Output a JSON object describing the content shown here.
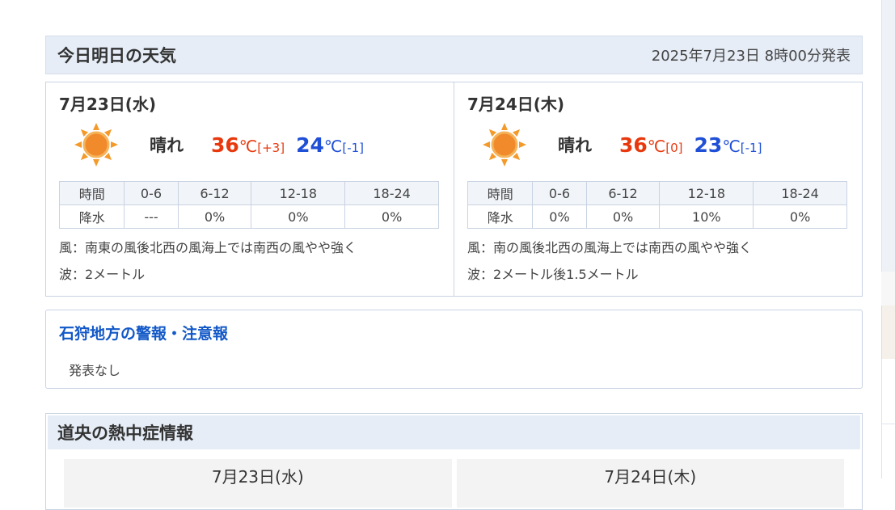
{
  "header": {
    "title": "今日明日の天気",
    "issued": "2025年7月23日 8時00分発表"
  },
  "days": [
    {
      "date": "7月23日(水)",
      "weather": "晴れ",
      "icon": "sun-icon",
      "high": "36",
      "high_diff": "[+3]",
      "low": "24",
      "low_diff": "[-1]",
      "unit": "℃",
      "rain_header": [
        "時間",
        "0-6",
        "6-12",
        "12-18",
        "18-24"
      ],
      "rain_values": [
        "降水",
        "---",
        "0%",
        "0%",
        "0%"
      ],
      "wind": "風：南東の風後北西の風海上では南西の風やや強く",
      "wave": "波：2メートル"
    },
    {
      "date": "7月24日(木)",
      "weather": "晴れ",
      "icon": "sun-icon",
      "high": "36",
      "high_diff": "[0]",
      "low": "23",
      "low_diff": "[-1]",
      "unit": "℃",
      "rain_header": [
        "時間",
        "0-6",
        "6-12",
        "12-18",
        "18-24"
      ],
      "rain_values": [
        "降水",
        "0%",
        "0%",
        "10%",
        "0%"
      ],
      "wind": "風：南の風後北西の風海上では南西の風やや強く",
      "wave": "波：2メートル後1.5メートル"
    }
  ],
  "warnings": {
    "title": "石狩地方の警報・注意報",
    "text": "発表なし"
  },
  "heat": {
    "title": "道央の熱中症情報",
    "days": [
      "7月23日(水)",
      "7月24日(木)"
    ]
  },
  "colors": {
    "high": "#e8380d",
    "low": "#1e4fd6",
    "accent": "#1258c7",
    "header_bg": "#e6edf7"
  }
}
